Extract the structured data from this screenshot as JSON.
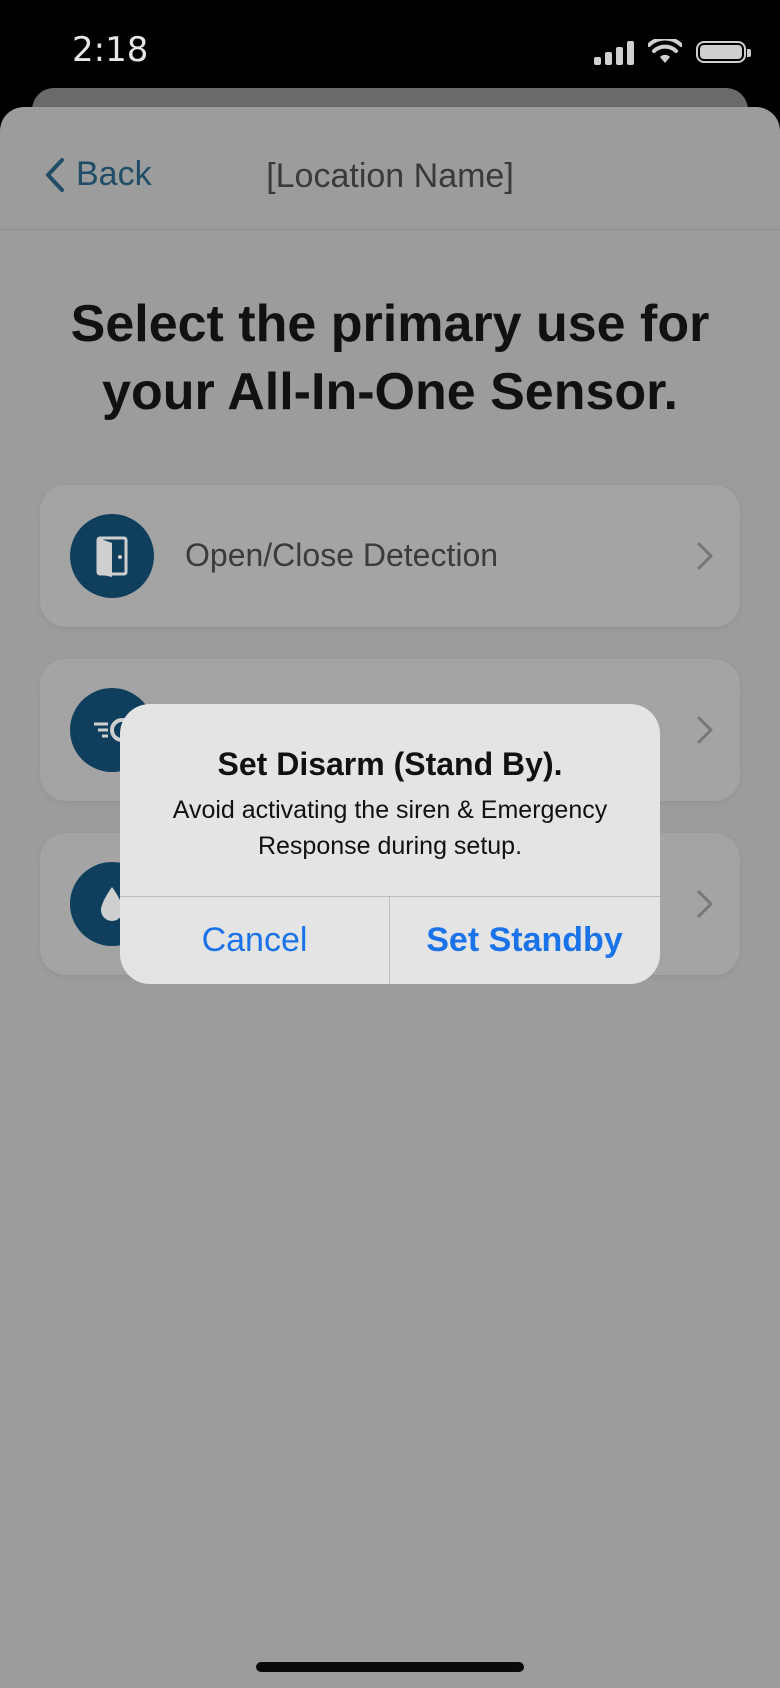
{
  "status_bar": {
    "time": "2:18"
  },
  "nav": {
    "back_label": "Back",
    "title": "[Location Name]"
  },
  "heading": "Select the primary use for your All-In-One Sensor.",
  "options": [
    {
      "label": "Open/Close Detection",
      "icon": "door-icon"
    },
    {
      "label": "",
      "icon": "motion-icon"
    },
    {
      "label": "",
      "icon": "water-drop-icon"
    }
  ],
  "dialog": {
    "title": "Set Disarm (Stand By).",
    "message": "Avoid activating the siren & Emergency Response during setup.",
    "cancel_label": "Cancel",
    "confirm_label": "Set Standby"
  },
  "colors": {
    "accent": "#1A73E8",
    "icon_bg": "#0F3F5C",
    "back_link": "#1F4D68"
  }
}
